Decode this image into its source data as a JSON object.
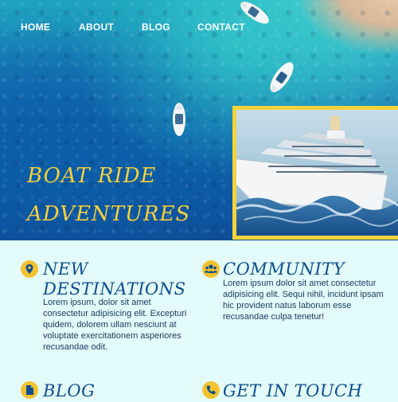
{
  "nav": {
    "items": [
      {
        "label": "HOME"
      },
      {
        "label": "ABOUT"
      },
      {
        "label": "BLOG"
      },
      {
        "label": "CONTACT"
      }
    ]
  },
  "hero": {
    "title_line1": "BOAT RIDE",
    "title_line2": "ADVENTURES"
  },
  "features": [
    {
      "icon": "location-pin-icon",
      "title_line1": "NEW",
      "title_line2": "DESTINATIONS",
      "body": "Lorem ipsum, dolor sit amet consectetur adipisicing elit. Excepturi quidem, dolorem ullam nesciunt at voluptate exercitationem asperiores recusandae odit."
    },
    {
      "icon": "people-group-icon",
      "title_line1": "COMMUNITY",
      "body": "Lorem ipsum dolor sit amet consectetur adipisicing elit. Sequi nihil, incidunt ipsam hic provident natus laborum esse recusandae culpa tenetur!"
    },
    {
      "icon": "document-icon",
      "title_line1": "BLOG"
    },
    {
      "icon": "phone-icon",
      "title_line1": "GET IN TOUCH"
    }
  ],
  "colors": {
    "accent_yellow": "#f2c230",
    "heading_blue": "#0c4e8f",
    "section_bg": "#e3fbfa"
  }
}
